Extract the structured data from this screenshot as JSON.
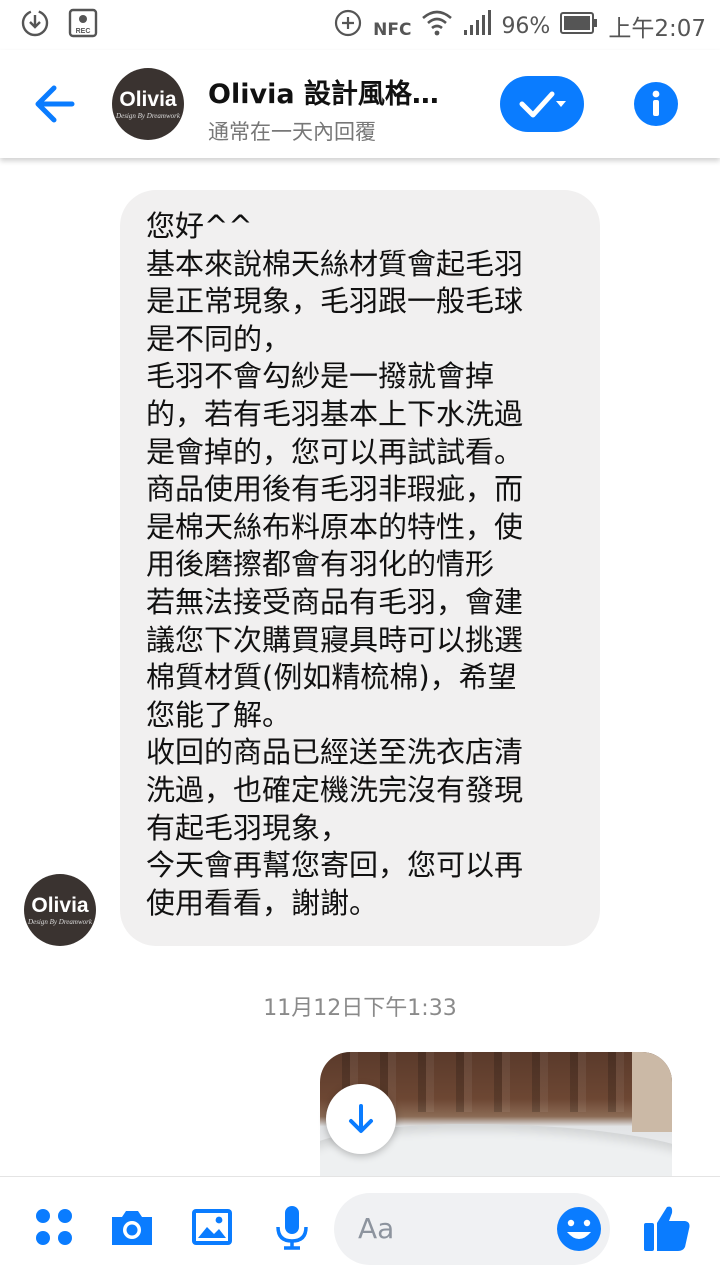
{
  "status_bar": {
    "battery_percent": "96%",
    "time": "上午2:07",
    "nfc_label": "NFC",
    "rec_label": "REC",
    "icons": [
      "download-icon",
      "screen-record-icon",
      "add-circle-icon",
      "nfc-icon",
      "wifi-icon",
      "signal-icon",
      "battery-icon"
    ]
  },
  "header": {
    "title": "Olivia 設計風格…",
    "subtitle": "通常在一天內回覆",
    "avatar_name": "Olivia",
    "avatar_tagline": "Design By Dreamwork",
    "icons": [
      "back-arrow-icon",
      "check-dropdown-icon",
      "info-icon"
    ]
  },
  "conversation": {
    "message_lines": [
      "您好^^",
      "基本來說棉天絲材質會起毛羽",
      "是正常現象，毛羽跟一般毛球",
      "是不同的，",
      "毛羽不會勾紗是一撥就會掉",
      "的，若有毛羽基本上下水洗過",
      "是會掉的，您可以再試試看。",
      "商品使用後有毛羽非瑕疵，而",
      "是棉天絲布料原本的特性，使",
      "用後磨擦都會有羽化的情形",
      "若無法接受商品有毛羽，會建",
      "議您下次購買寢具時可以挑選",
      "棉質材質(例如精梳棉)，希望",
      "您能了解。",
      "收回的商品已經送至洗衣店清",
      "洗過，也確定機洗完沒有發現",
      "有起毛羽現象，",
      "今天會再幫您寄回，您可以再",
      "使用看看，謝謝。"
    ],
    "sender_avatar_name": "Olivia",
    "sender_avatar_tagline": "Design By Dreamwork",
    "timestamp": "11月12日下午1:33",
    "photo_attachment": "bedding-photo",
    "scroll_button_icon": "arrow-down-icon"
  },
  "composer": {
    "placeholder": "Aa",
    "icons": [
      "more-apps-icon",
      "camera-icon",
      "gallery-icon",
      "microphone-icon",
      "emoji-icon",
      "thumbs-up-icon"
    ]
  },
  "colors": {
    "accent": "#0a7cff",
    "bubble": "#f1f0f0",
    "avatar_bg": "#3a3330"
  }
}
